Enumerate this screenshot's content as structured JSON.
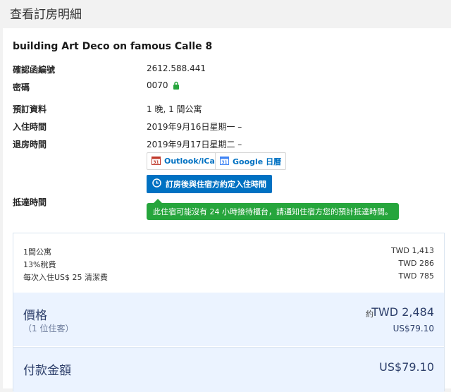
{
  "header": {
    "title": "查看訂房明細"
  },
  "booking": {
    "hotel_name": "building Art Deco on famous Calle 8",
    "confirmation_label": "確認函編號",
    "confirmation_value": "2612.588.441",
    "pin_label": "密碼",
    "pin_value": "0070",
    "details_label": "預訂資料",
    "details_value": "1 晚, 1 間公寓",
    "checkin_label": "入住時間",
    "checkin_value": "2019年9月16日星期一 –",
    "checkout_label": "退房時間",
    "checkout_value": "2019年9月17日星期二 –",
    "arrival_label": "抵達時間"
  },
  "calendar": {
    "outlook_label": "Outlook/iCal",
    "google_label": "Google 日曆"
  },
  "arrival": {
    "button_label": "訂房後與住宿方約定入住時間",
    "tooltip": "此住宿可能沒有 24 小時接待櫃台，請通知住宿方您的預計抵達時間。"
  },
  "price": {
    "items": [
      {
        "label": "1間公寓",
        "amount": "TWD 1,413"
      },
      {
        "label": "13%稅費",
        "amount": "TWD 286"
      },
      {
        "label": "每次入住US$ 25 清潔費",
        "amount": "TWD 785"
      }
    ],
    "total_label": "價格",
    "guests": "（1 位住客）",
    "approx": "約",
    "total_twd": "TWD 2,484",
    "total_usd": "US$79.10",
    "pay_label": "付款金額",
    "pay_amount": "US$79.10"
  },
  "colors": {
    "accent": "#0071c2",
    "success": "#26a53c",
    "price_bg": "#ebf3ff"
  }
}
